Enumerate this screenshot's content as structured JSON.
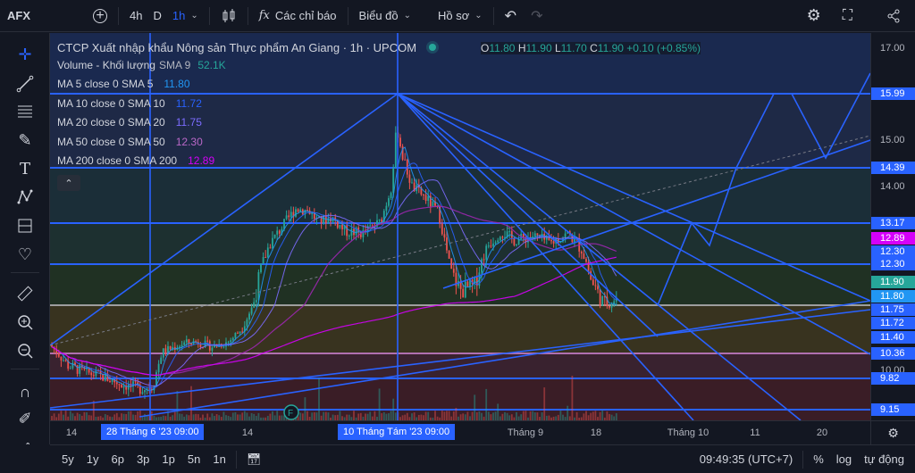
{
  "toolbar": {
    "symbol": "AFX",
    "intervals": [
      "4h",
      "D",
      "1h"
    ],
    "indicators_label": "Các chỉ báo",
    "chart_type_label": "Biểu đồ",
    "profile_label": "Hồ sơ"
  },
  "legend": {
    "title": "CTCP Xuất nhập khẩu Nông sản Thực phẩm An Giang · 1h · UPCOM",
    "ohlc": {
      "o": "11.80",
      "h": "11.90",
      "l": "11.70",
      "c": "11.90",
      "chg": "+0.10 (+0.85%)"
    },
    "rows": [
      {
        "label": "Volume - Khối lượng",
        "sub": "SMA 9",
        "value": "52.1K",
        "color": "#26a69a"
      },
      {
        "label": "MA 5 close 0 SMA 5",
        "sub": "",
        "value": "11.80",
        "color": "#2196f3"
      },
      {
        "label": "MA 10 close 0 SMA 10",
        "sub": "",
        "value": "11.72",
        "color": "#2962ff"
      },
      {
        "label": "MA 20 close 0 SMA 20",
        "sub": "",
        "value": "11.75",
        "color": "#5b5fff"
      },
      {
        "label": "MA 50 close 0 SMA 50",
        "sub": "",
        "value": "12.30",
        "color": "#9c27b0"
      },
      {
        "label": "MA 200 close 0 SMA 200",
        "sub": "",
        "value": "12.89",
        "color": "#d500f9"
      }
    ]
  },
  "price_axis": {
    "ticks": [
      "17.00",
      "15.00",
      "14.00",
      "10.00"
    ],
    "labels": [
      {
        "text": "15.99",
        "bg": "#2962ff"
      },
      {
        "text": "14.39",
        "bg": "#2962ff"
      },
      {
        "text": "13.17",
        "bg": "#2962ff"
      },
      {
        "text": "12.89",
        "bg": "#d500f9"
      },
      {
        "text": "12.30",
        "bg": "#2962ff"
      },
      {
        "text": "12.30",
        "bg": "#2962ff"
      },
      {
        "text": "11.90",
        "bg": "#26a69a"
      },
      {
        "text": "11.80",
        "bg": "#2196f3"
      },
      {
        "text": "11.75",
        "bg": "#2962ff"
      },
      {
        "text": "11.72",
        "bg": "#2962ff"
      },
      {
        "text": "11.40",
        "bg": "#2962ff"
      },
      {
        "text": "10.36",
        "bg": "#2962ff"
      },
      {
        "text": "9.82",
        "bg": "#2962ff"
      },
      {
        "text": "9.15",
        "bg": "#2962ff"
      }
    ]
  },
  "time_axis": {
    "ticks": [
      "14",
      "14",
      "Tháng 9",
      "18",
      "Tháng 10",
      "11",
      "20"
    ],
    "labels": [
      "28 Tháng 6 '23   09:00",
      "10 Tháng Tám '23   09:00"
    ]
  },
  "bottom": {
    "ranges": [
      "5y",
      "1y",
      "6p",
      "3p",
      "1p",
      "5n",
      "1n"
    ],
    "clock": "09:49:35 (UTC+7)",
    "pct": "%",
    "log": "log",
    "auto": "tự động"
  },
  "colors": {
    "bg": "#131722",
    "up": "#26a69a",
    "down": "#ef5350",
    "line": "#2962ff"
  },
  "chart_data": {
    "type": "line",
    "title": "",
    "ylim": [
      9.0,
      17.2
    ],
    "levels": [
      15.99,
      14.39,
      13.17,
      12.3,
      11.75,
      10.36,
      9.82,
      9.15
    ]
  }
}
